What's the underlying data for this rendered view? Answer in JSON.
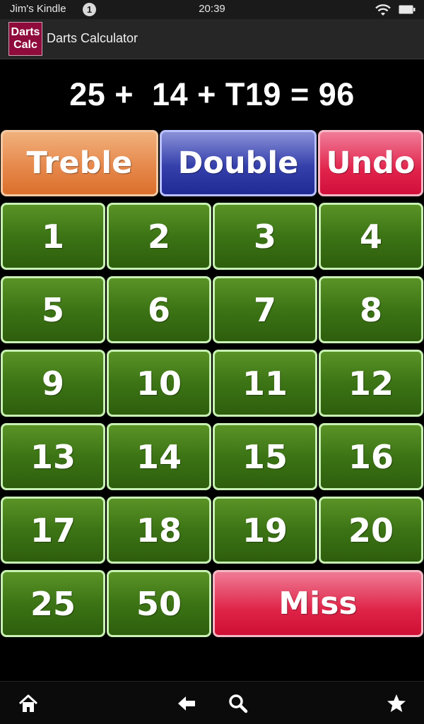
{
  "status_bar": {
    "owner": "Jim's Kindle",
    "notification_count": "1",
    "time": "20:39",
    "icons": [
      "wifi-icon",
      "battery-icon"
    ]
  },
  "action_bar": {
    "icon_line1": "Darts",
    "icon_line2": "Calc",
    "title": "Darts Calculator"
  },
  "expression": "25 +  14 + T19 = 96",
  "modifiers": {
    "treble": "Treble",
    "double": "Double",
    "undo": "Undo"
  },
  "numbers": [
    "1",
    "2",
    "3",
    "4",
    "5",
    "6",
    "7",
    "8",
    "9",
    "10",
    "11",
    "12",
    "13",
    "14",
    "15",
    "16",
    "17",
    "18",
    "19",
    "20",
    "25",
    "50"
  ],
  "miss": "Miss",
  "nav_bar": {
    "icons": [
      "home-icon",
      "back-icon",
      "search-icon",
      "favorite-star-icon"
    ]
  },
  "colors": {
    "number_button": "#3c7415",
    "treble": "#e6894c",
    "double": "#3540ab",
    "undo_miss": "#e1244c",
    "app_icon": "#8e0b3c"
  }
}
